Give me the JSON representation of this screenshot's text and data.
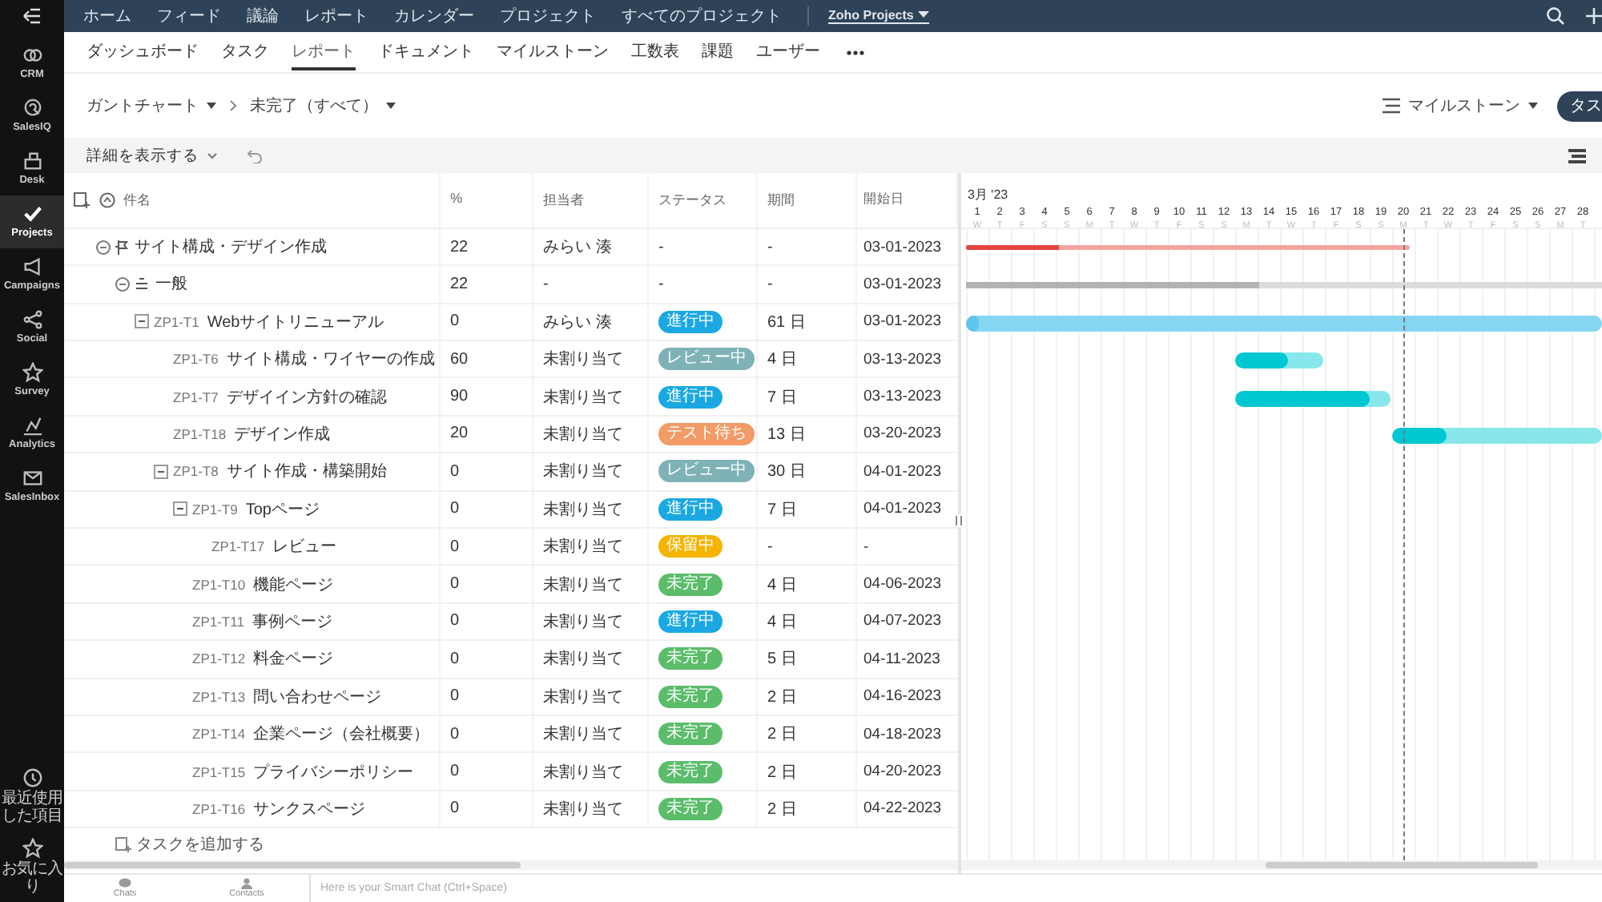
{
  "sidebar": {
    "items": [
      {
        "label": "CRM",
        "selected": false
      },
      {
        "label": "SalesIQ",
        "selected": false
      },
      {
        "label": "Desk",
        "selected": false
      },
      {
        "label": "Projects",
        "selected": true
      },
      {
        "label": "Campaigns",
        "selected": false
      },
      {
        "label": "Social",
        "selected": false
      },
      {
        "label": "Survey",
        "selected": false
      },
      {
        "label": "Analytics",
        "selected": false
      },
      {
        "label": "SalesInbox",
        "selected": false
      }
    ],
    "bottom_items": [
      {
        "label": "最近使用した項目"
      },
      {
        "label": "お気に入り"
      }
    ]
  },
  "top_nav": {
    "items": [
      "ホーム",
      "フィード",
      "議論",
      "レポート",
      "カレンダー",
      "プロジェクト",
      "すべてのプロジェクト"
    ],
    "project_switcher": "Zoho Projects"
  },
  "tabs": [
    {
      "label": "ダッシュボード",
      "selected": false
    },
    {
      "label": "タスク",
      "selected": false
    },
    {
      "label": "レポート",
      "selected": true
    },
    {
      "label": "ドキュメント",
      "selected": false
    },
    {
      "label": "マイルストーン",
      "selected": false
    },
    {
      "label": "工数表",
      "selected": false
    },
    {
      "label": "課題",
      "selected": false
    },
    {
      "label": "ユーザー",
      "selected": false
    }
  ],
  "breadcrumb": [
    "ガントチャート",
    "未完了（すべて）"
  ],
  "group_by": "マイルストーン",
  "task_button": "タス",
  "toolbar": {
    "details_button": "詳細を表示する"
  },
  "table": {
    "columns": [
      "件名",
      "%",
      "担当者",
      "ステータス",
      "期間",
      "開始日"
    ],
    "tasks": [
      {
        "kind": "milestone",
        "name": "サイト構成・デザイン作成",
        "percent": "22",
        "owner": "みらい 湊",
        "status": {
          "label": "-"
        },
        "duration": "-",
        "start_date": "03-01-2023",
        "expanded": true,
        "children": [
          {
            "kind": "tasklist",
            "name": "一般",
            "percent": "22",
            "owner": "-",
            "status": {
              "label": "-"
            },
            "duration": "-",
            "start_date": "03-01-2023",
            "expanded": true,
            "children": [
              {
                "kind": "task",
                "id": "ZP1-T1",
                "name": "Webサイトリニューアル",
                "percent": "0",
                "owner": "みらい 湊",
                "status": {
                  "label": "進行中",
                  "color": "#1ba8e2"
                },
                "duration": "61 日",
                "start_date": "03-01-2023",
                "expanded": true,
                "children": [
                  {
                    "kind": "task",
                    "id": "ZP1-T6",
                    "name": "サイト構成・ワイヤーの作成",
                    "percent": "60",
                    "owner": "未割り当て",
                    "status": {
                      "label": "レビュー中",
                      "color": "#7fb2b6"
                    },
                    "duration": "4 日",
                    "start_date": "03-13-2023"
                  },
                  {
                    "kind": "task",
                    "id": "ZP1-T7",
                    "name": "デザイイン方針の確認",
                    "percent": "90",
                    "owner": "未割り当て",
                    "status": {
                      "label": "進行中",
                      "color": "#1ba8e2"
                    },
                    "duration": "7 日",
                    "start_date": "03-13-2023"
                  },
                  {
                    "kind": "task",
                    "id": "ZP1-T18",
                    "name": "デザイン作成",
                    "percent": "20",
                    "owner": "未割り当て",
                    "status": {
                      "label": "テスト待ち",
                      "color": "#f29b66"
                    },
                    "duration": "13 日",
                    "start_date": "03-20-2023"
                  },
                  {
                    "kind": "task",
                    "id": "ZP1-T8",
                    "name": "サイト作成・構築開始",
                    "percent": "0",
                    "owner": "未割り当て",
                    "status": {
                      "label": "レビュー中",
                      "color": "#7fb2b6"
                    },
                    "duration": "30 日",
                    "start_date": "04-01-2023",
                    "expanded": true,
                    "children": [
                      {
                        "kind": "task",
                        "id": "ZP1-T9",
                        "name": "Topページ",
                        "percent": "0",
                        "owner": "未割り当て",
                        "status": {
                          "label": "進行中",
                          "color": "#1ba8e2"
                        },
                        "duration": "7 日",
                        "start_date": "04-01-2023",
                        "expanded": true,
                        "children": [
                          {
                            "kind": "task",
                            "id": "ZP1-T17",
                            "name": "レビュー",
                            "percent": "0",
                            "owner": "未割り当て",
                            "status": {
                              "label": "保留中",
                              "color": "#f5b400"
                            },
                            "duration": "-",
                            "start_date": "-"
                          }
                        ]
                      },
                      {
                        "kind": "task",
                        "id": "ZP1-T10",
                        "name": "機能ページ",
                        "percent": "0",
                        "owner": "未割り当て",
                        "status": {
                          "label": "未完了",
                          "color": "#5bbd6b"
                        },
                        "duration": "4 日",
                        "start_date": "04-06-2023"
                      },
                      {
                        "kind": "task",
                        "id": "ZP1-T11",
                        "name": "事例ページ",
                        "percent": "0",
                        "owner": "未割り当て",
                        "status": {
                          "label": "進行中",
                          "color": "#1ba8e2"
                        },
                        "duration": "4 日",
                        "start_date": "04-07-2023"
                      },
                      {
                        "kind": "task",
                        "id": "ZP1-T12",
                        "name": "料金ページ",
                        "percent": "0",
                        "owner": "未割り当て",
                        "status": {
                          "label": "未完了",
                          "color": "#5bbd6b"
                        },
                        "duration": "5 日",
                        "start_date": "04-11-2023"
                      },
                      {
                        "kind": "task",
                        "id": "ZP1-T13",
                        "name": "問い合わせページ",
                        "percent": "0",
                        "owner": "未割り当て",
                        "status": {
                          "label": "未完了",
                          "color": "#5bbd6b"
                        },
                        "duration": "2 日",
                        "start_date": "04-16-2023"
                      },
                      {
                        "kind": "task",
                        "id": "ZP1-T14",
                        "name": "企業ページ（会社概要）",
                        "percent": "0",
                        "owner": "未割り当て",
                        "status": {
                          "label": "未完了",
                          "color": "#5bbd6b"
                        },
                        "duration": "2 日",
                        "start_date": "04-18-2023"
                      },
                      {
                        "kind": "task",
                        "id": "ZP1-T15",
                        "name": "プライバシーポリシー",
                        "percent": "0",
                        "owner": "未割り当て",
                        "status": {
                          "label": "未完了",
                          "color": "#5bbd6b"
                        },
                        "duration": "2 日",
                        "start_date": "04-20-2023"
                      },
                      {
                        "kind": "task",
                        "id": "ZP1-T16",
                        "name": "サンクスページ",
                        "percent": "0",
                        "owner": "未割り当て",
                        "status": {
                          "label": "未完了",
                          "color": "#5bbd6b"
                        },
                        "duration": "2 日",
                        "start_date": "04-22-2023"
                      }
                    ]
                  }
                ]
              }
            ]
          }
        ]
      }
    ],
    "add_task": "タスクを追加する"
  },
  "gantt": {
    "month_label": "3月 '23",
    "days": [
      "1",
      "2",
      "3",
      "4",
      "5",
      "6",
      "7",
      "8",
      "9",
      "10",
      "11",
      "12",
      "13",
      "14",
      "15",
      "16",
      "17",
      "18",
      "19",
      "20",
      "21",
      "22",
      "23",
      "24",
      "25",
      "26",
      "27",
      "28"
    ],
    "bars": [
      {
        "kind": "milestone",
        "level": 0.21
      },
      {
        "kind": "tasklist",
        "level": 0.46
      },
      {
        "kind": "parent_task",
        "level": 0.01
      },
      {
        "kind": "task",
        "level": 0.6
      },
      {
        "kind": "task",
        "level": 0.87
      },
      {
        "kind": "task",
        "level": 0.26
      }
    ],
    "weekday_labels": [
      "W",
      "T",
      "F",
      "S",
      "S",
      "M",
      "T",
      "W",
      "T",
      "F",
      "S",
      "S",
      "M",
      "T",
      "W",
      "T",
      "F",
      "S",
      "S",
      "M",
      "T",
      "W",
      "T",
      "F",
      "S",
      "S",
      "M",
      "T"
    ]
  },
  "bottom_bar": {
    "items": [
      "Chats",
      "Contacts"
    ],
    "chat_placeholder": "Here is your Smart Chat (Ctrl+Space)"
  }
}
